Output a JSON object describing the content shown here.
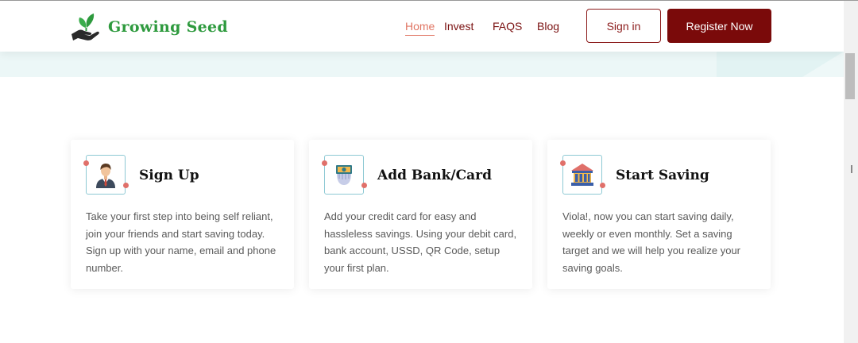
{
  "brand": {
    "name": "Growing Seed",
    "accent_green": "#2e9a3e",
    "accent_maroon": "#7a0a0a"
  },
  "nav": {
    "items": [
      {
        "label": "Home",
        "active": true
      },
      {
        "label": "Invest",
        "active": false
      },
      {
        "label": "FAQS",
        "active": false
      },
      {
        "label": "Blog",
        "active": false
      }
    ],
    "signin_label": "Sign in",
    "register_label": "Register Now"
  },
  "steps": [
    {
      "title": "Sign Up",
      "icon": "businessman-icon",
      "description": "Take your first step into being self reliant, join your friends and start saving today. Sign up with your name, email and phone number."
    },
    {
      "title": "Add Bank/Card",
      "icon": "money-hand-icon",
      "description": "Add your credit card for easy and hassleless savings. Using your debit card, bank account, USSD, QR Code, setup your first plan."
    },
    {
      "title": "Start Saving",
      "icon": "bank-icon",
      "description": "Viola!, now you can start saving daily, weekly or even monthly. Set a saving target and we will help you realize your saving goals."
    }
  ]
}
